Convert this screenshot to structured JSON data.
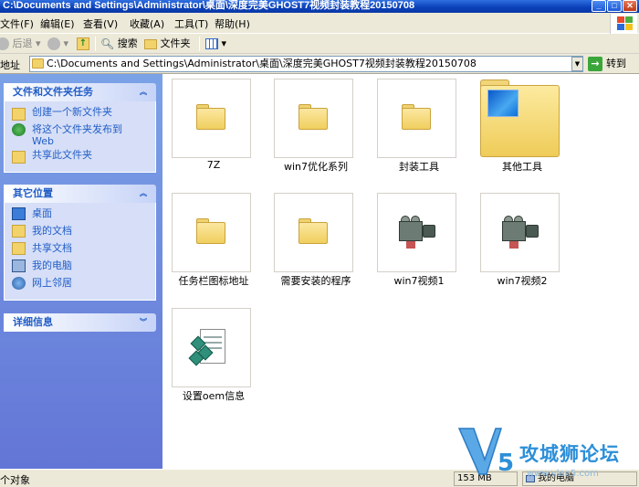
{
  "window": {
    "title": "C:\\Documents and Settings\\Administrator\\桌面\\深度完美GHOST7视频封装教程20150708"
  },
  "menu": [
    "文件(F)",
    "编辑(E)",
    "查看(V)",
    "收藏(A)",
    "工具(T)",
    "帮助(H)"
  ],
  "toolbar": {
    "back": "后退",
    "search": "搜索",
    "folders": "文件夹"
  },
  "address": {
    "label": "地址",
    "value": "C:\\Documents and Settings\\Administrator\\桌面\\深度完美GHOST7视频封装教程20150708",
    "go": "转到"
  },
  "sidebar": {
    "tasks": {
      "title": "文件和文件夹任务",
      "items": [
        {
          "label": "创建一个新文件夹",
          "icon": "new-folder-icon"
        },
        {
          "label": "将这个文件夹发布到 Web",
          "icon": "publish-web-icon"
        },
        {
          "label": "共享此文件夹",
          "icon": "share-folder-icon"
        }
      ]
    },
    "places": {
      "title": "其它位置",
      "items": [
        {
          "label": "桌面",
          "icon": "desktop-icon"
        },
        {
          "label": "我的文档",
          "icon": "my-documents-icon"
        },
        {
          "label": "共享文档",
          "icon": "shared-documents-icon"
        },
        {
          "label": "我的电脑",
          "icon": "my-computer-icon"
        },
        {
          "label": "网上邻居",
          "icon": "network-icon"
        }
      ]
    },
    "details": {
      "title": "详细信息"
    }
  },
  "files": [
    {
      "name": "7Z",
      "type": "folder"
    },
    {
      "name": "win7优化系列",
      "type": "folder"
    },
    {
      "name": "封装工具",
      "type": "folder"
    },
    {
      "name": "其他工具",
      "type": "folder-picture"
    },
    {
      "name": "任务栏图标地址",
      "type": "folder"
    },
    {
      "name": "需要安装的程序",
      "type": "folder"
    },
    {
      "name": "win7视频1",
      "type": "video"
    },
    {
      "name": "win7视频2",
      "type": "video"
    },
    {
      "name": "设置oem信息",
      "type": "script"
    }
  ],
  "status": {
    "left": "个对象",
    "size": "153 MB",
    "location": "我的电脑"
  },
  "watermark": {
    "brand": "攻城狮论坛",
    "url": "www.vlan5.com"
  },
  "colors": {
    "title_bar": "#0a3fb8",
    "sidebar_bg": "#6f8fe0",
    "link": "#215dc6",
    "watermark": "#2d8fd8"
  }
}
